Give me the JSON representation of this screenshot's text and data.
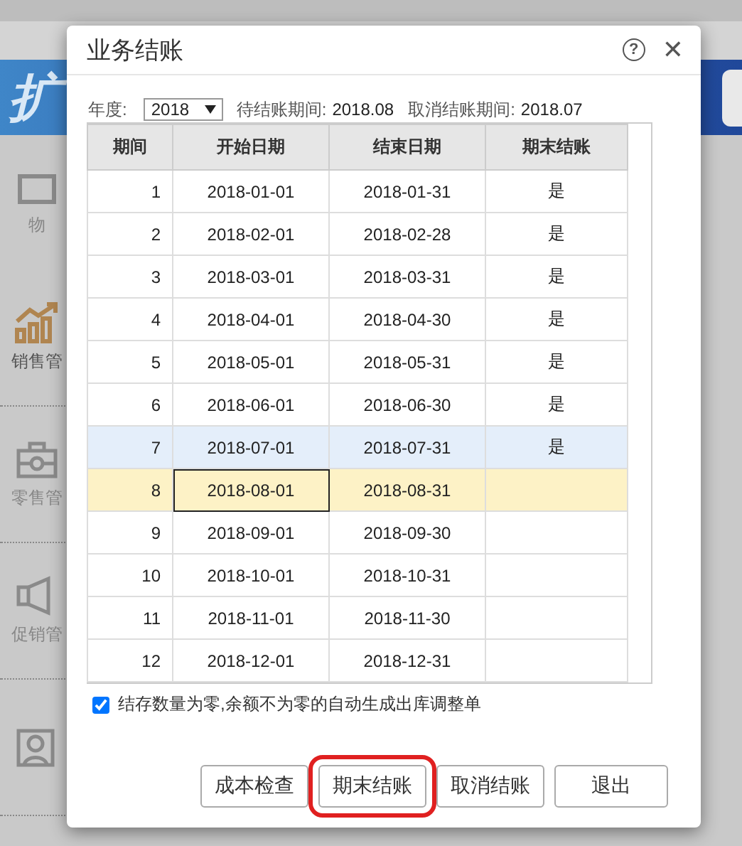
{
  "background": {
    "banner_text": "扩",
    "sidebar": [
      {
        "label": "物",
        "selected": false
      },
      {
        "label": "销售管",
        "selected": true
      },
      {
        "label": "零售管",
        "selected": false
      },
      {
        "label": "促销管",
        "selected": false
      },
      {
        "selected": false
      }
    ]
  },
  "dialog": {
    "title": "业务结账",
    "help_glyph": "?",
    "close_glyph": "✕",
    "year_label": "年度:",
    "year_value": "2018",
    "pending_label": "待结账期间:",
    "pending_value": "2018.08",
    "cancel_label": "取消结账期间:",
    "cancel_value": "2018.07",
    "columns": [
      "期间",
      "开始日期",
      "结束日期",
      "期末结账"
    ],
    "rows": [
      {
        "period": "1",
        "start": "2018-01-01",
        "end": "2018-01-31",
        "closed": "是",
        "selected": false,
        "highlighted": false
      },
      {
        "period": "2",
        "start": "2018-02-01",
        "end": "2018-02-28",
        "closed": "是",
        "selected": false,
        "highlighted": false
      },
      {
        "period": "3",
        "start": "2018-03-01",
        "end": "2018-03-31",
        "closed": "是",
        "selected": false,
        "highlighted": false
      },
      {
        "period": "4",
        "start": "2018-04-01",
        "end": "2018-04-30",
        "closed": "是",
        "selected": false,
        "highlighted": false
      },
      {
        "period": "5",
        "start": "2018-05-01",
        "end": "2018-05-31",
        "closed": "是",
        "selected": false,
        "highlighted": false
      },
      {
        "period": "6",
        "start": "2018-06-01",
        "end": "2018-06-30",
        "closed": "是",
        "selected": false,
        "highlighted": false
      },
      {
        "period": "7",
        "start": "2018-07-01",
        "end": "2018-07-31",
        "closed": "是",
        "selected": false,
        "highlighted": true
      },
      {
        "period": "8",
        "start": "2018-08-01",
        "end": "2018-08-31",
        "selected": true,
        "highlighted": false
      },
      {
        "period": "9",
        "start": "2018-09-01",
        "end": "2018-09-30",
        "selected": false,
        "highlighted": false
      },
      {
        "period": "10",
        "start": "2018-10-01",
        "end": "2018-10-31",
        "selected": false,
        "highlighted": false
      },
      {
        "period": "11",
        "start": "2018-11-01",
        "end": "2018-11-30",
        "selected": false,
        "highlighted": false
      },
      {
        "period": "12",
        "start": "2018-12-01",
        "end": "2018-12-31",
        "selected": false,
        "highlighted": false
      }
    ],
    "option": {
      "label": "结存数量为零,余额不为零的自动生成出库调整单",
      "checked": true
    },
    "buttons": [
      {
        "label": "成本检查",
        "emphasized": false
      },
      {
        "label": "期末结账",
        "emphasized": true
      },
      {
        "label": "取消结账",
        "emphasized": false
      },
      {
        "label": "退出",
        "emphasized": false
      }
    ]
  }
}
